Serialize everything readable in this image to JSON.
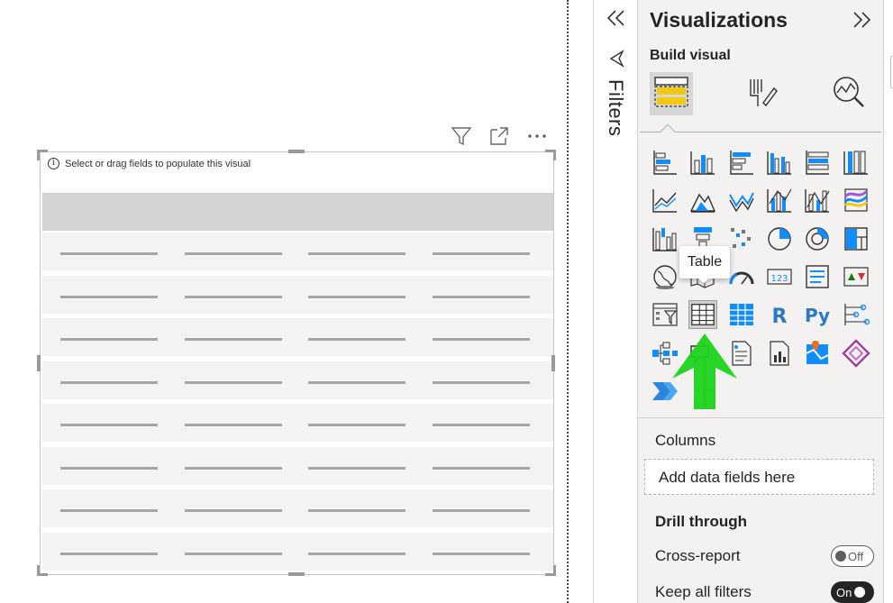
{
  "canvas": {
    "hint_text": "Select or drag fields to populate this visual",
    "info_glyph": "i",
    "toolbar_icons": [
      "filter-icon",
      "focus-mode-icon",
      "more-options-icon"
    ],
    "table_row_count": 8,
    "table_column_count": 4
  },
  "filters_rail": {
    "collapse_icon": "double-chevron-left-icon",
    "filter_icon": "funnel-icon",
    "label": "Filters"
  },
  "visualizations": {
    "title": "Visualizations",
    "expand_icon": "double-chevron-right-icon",
    "build_label": "Build visual",
    "tabs": [
      "build-visual-icon",
      "format-visual-icon",
      "analytics-icon"
    ],
    "selected_icon": "table",
    "tooltip": "Table",
    "more_glyph": "···",
    "icon_r": "R",
    "icon_py": "Py",
    "icon_card_text": "123"
  },
  "fields": {
    "columns_label": "Columns",
    "add_fields_placeholder": "Add data fields here"
  },
  "drill_through": {
    "label": "Drill through",
    "cross_report": {
      "label": "Cross-report",
      "state": "Off"
    },
    "keep_all_filters": {
      "label": "Keep all filters",
      "state": "On"
    }
  },
  "colors": {
    "accent_yellow": "#f2c811",
    "accent_blue": "#118dff",
    "arrow_green": "#1ed21e",
    "pane_bg": "#f3f2f1"
  }
}
